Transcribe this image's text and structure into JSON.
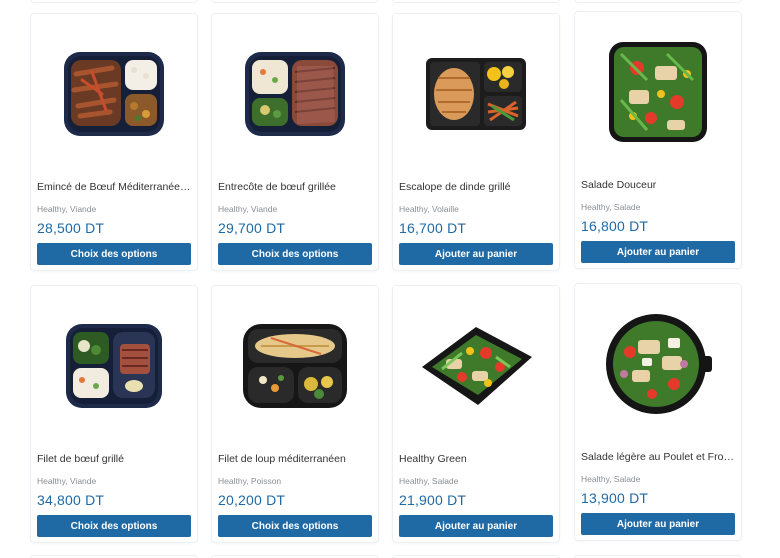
{
  "products": [
    {
      "name": "Emincé de Bœuf Méditerranéenne",
      "categories": "Healthy, Viande",
      "price": "28,500 DT",
      "button": "Choix des options",
      "image": "beef-strips-rice-meal-tray"
    },
    {
      "name": "Entrecôte de bœuf grillée",
      "categories": "Healthy, Viande",
      "price": "29,700 DT",
      "button": "Choix des options",
      "image": "grilled-steak-rice-meal-tray"
    },
    {
      "name": "Escalope de dinde grillé",
      "categories": "Healthy, Volaille",
      "price": "16,700 DT",
      "button": "Ajouter au panier",
      "image": "grilled-turkey-meal-tray"
    },
    {
      "name": "Salade Douceur",
      "categories": "Healthy, Salade",
      "price": "16,800 DT",
      "button": "Ajouter au panier",
      "image": "chicken-salad-square-bowl"
    },
    {
      "name": "Filet de bœuf grillé",
      "categories": "Healthy, Viande",
      "price": "34,800 DT",
      "button": "Choix des options",
      "image": "beef-fillet-meal-tray"
    },
    {
      "name": "Filet de loup méditerranéen",
      "categories": "Healthy, Poisson",
      "price": "20,200 DT",
      "button": "Choix des options",
      "image": "sea-bass-fillet-meal-tray"
    },
    {
      "name": "Healthy Green",
      "categories": "Healthy, Salade",
      "price": "21,900 DT",
      "button": "Ajouter au panier",
      "image": "green-salad-tray"
    },
    {
      "name": "Salade légère au Poulet et From...",
      "categories": "Healthy, Salade",
      "price": "13,900 DT",
      "button": "Ajouter au panier",
      "image": "chicken-cheese-salad-round-bowl"
    }
  ],
  "colors": {
    "accent": "#1f6aa5",
    "price": "#1f6aa5",
    "muted": "#8a8f96"
  }
}
